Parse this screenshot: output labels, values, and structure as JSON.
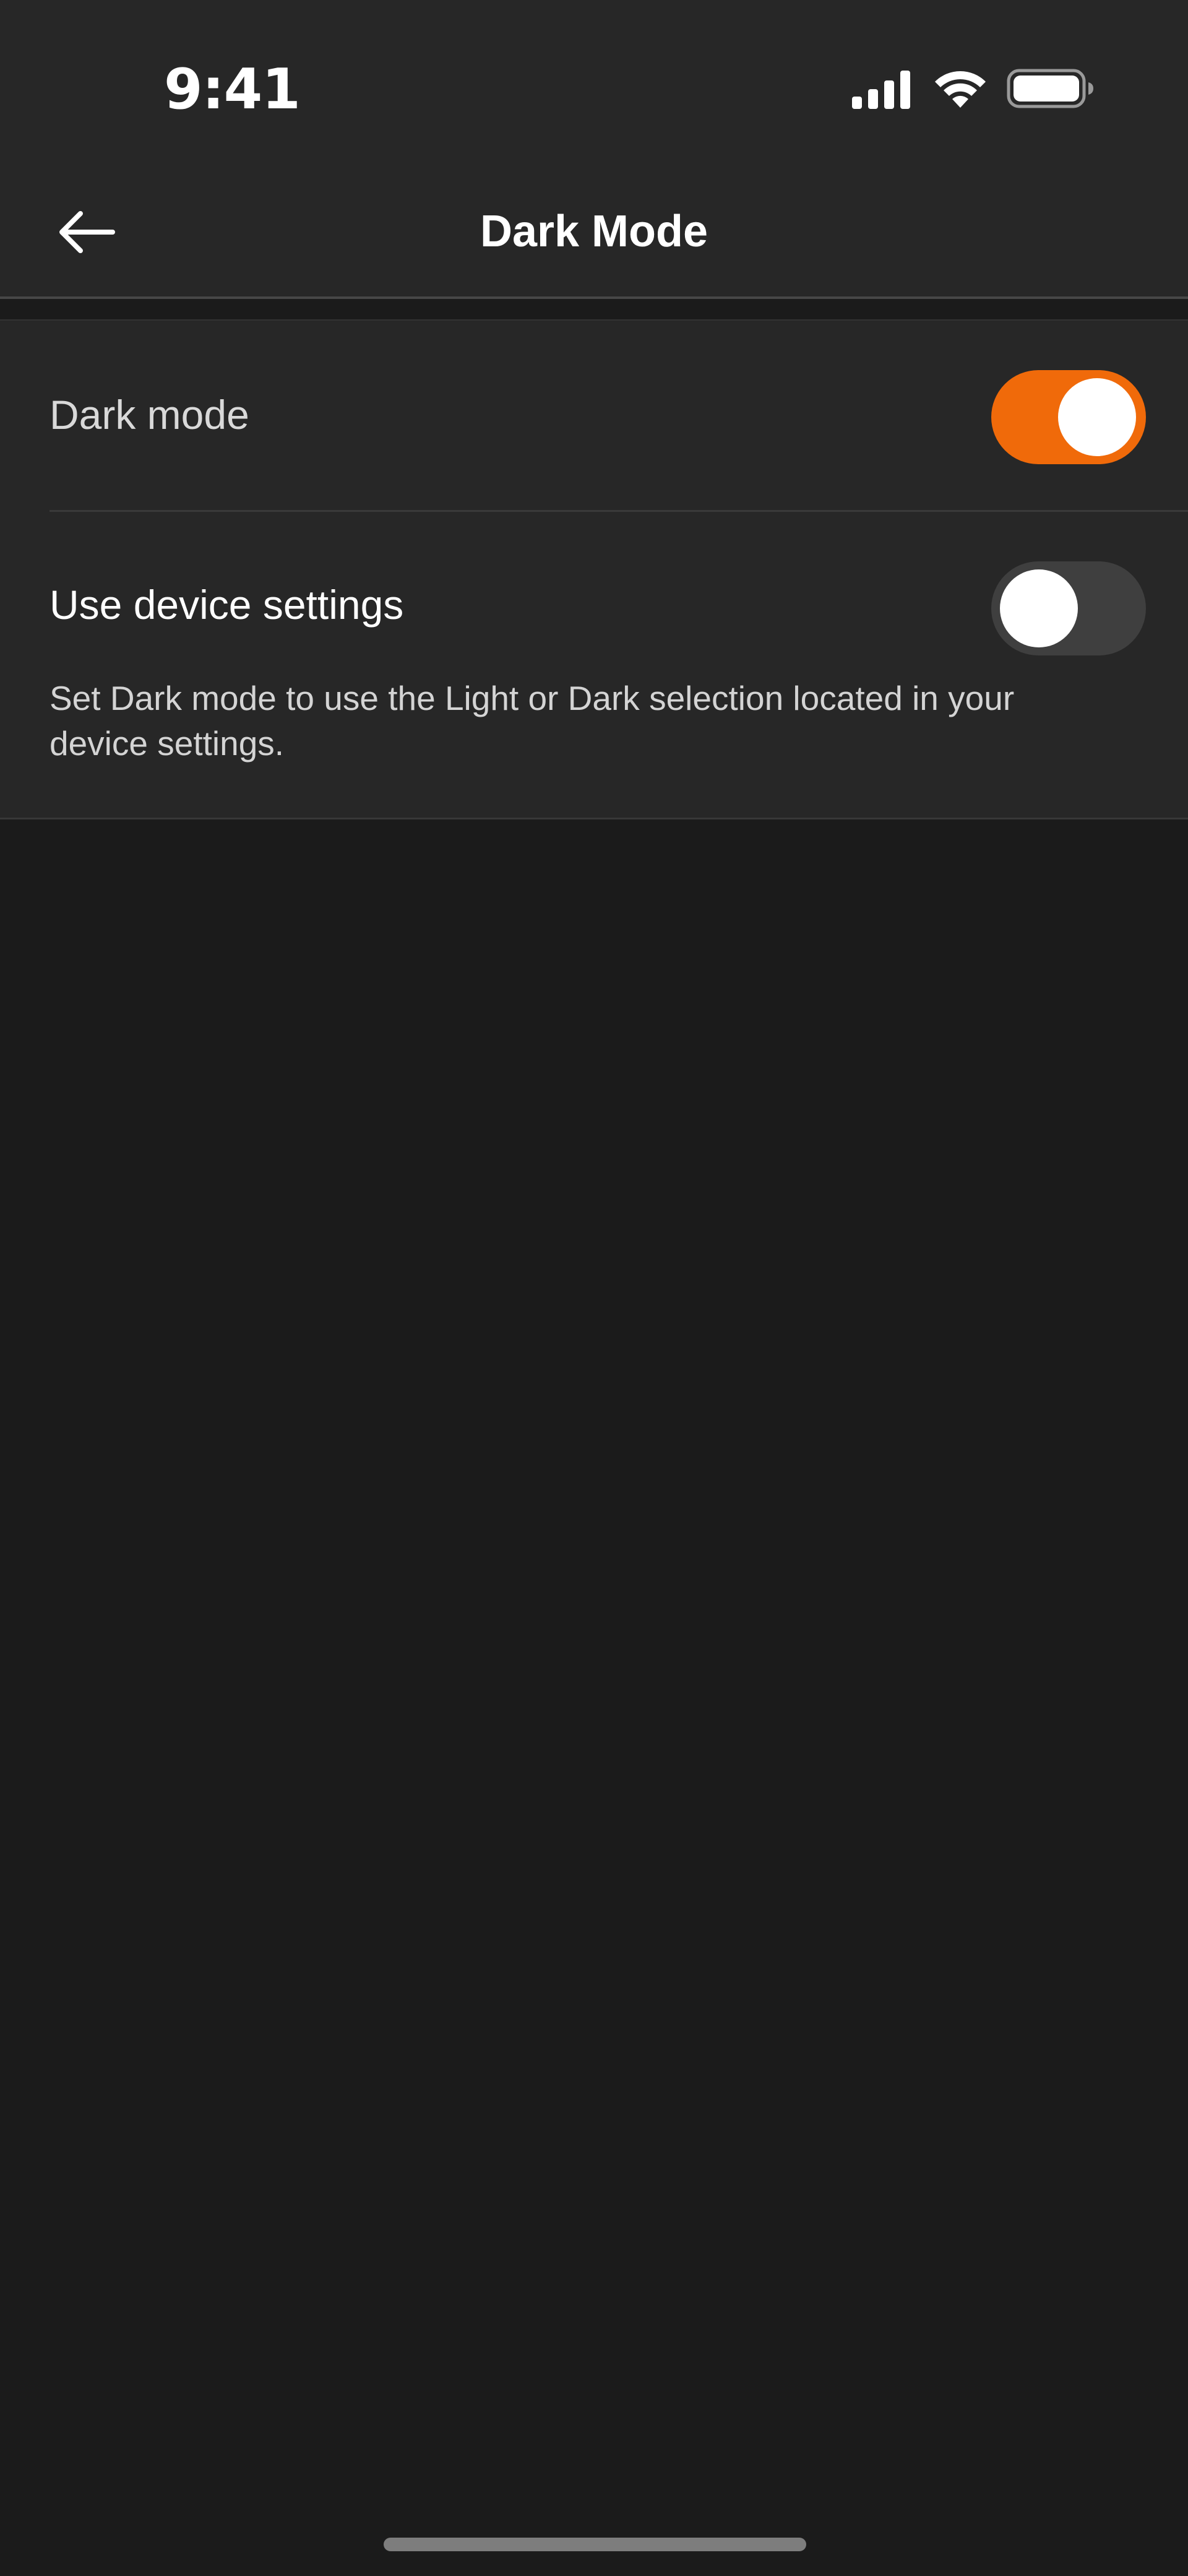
{
  "status_bar": {
    "time": "9:41",
    "signal_icon": "cellular-signal-icon",
    "wifi_icon": "wifi-icon",
    "battery_icon": "battery-icon"
  },
  "nav": {
    "title": "Dark Mode",
    "back_icon": "arrow-left-icon"
  },
  "settings": {
    "dark_mode": {
      "label": "Dark mode",
      "enabled": true
    },
    "device_settings": {
      "label": "Use device settings",
      "enabled": false,
      "description": "Set Dark mode to use the Light or Dark selection located in your device settings."
    }
  },
  "colors": {
    "accent": "#f06a0a",
    "background": "#1b1b1b",
    "surface": "#272727",
    "toggle_off": "#3f3f3f"
  }
}
